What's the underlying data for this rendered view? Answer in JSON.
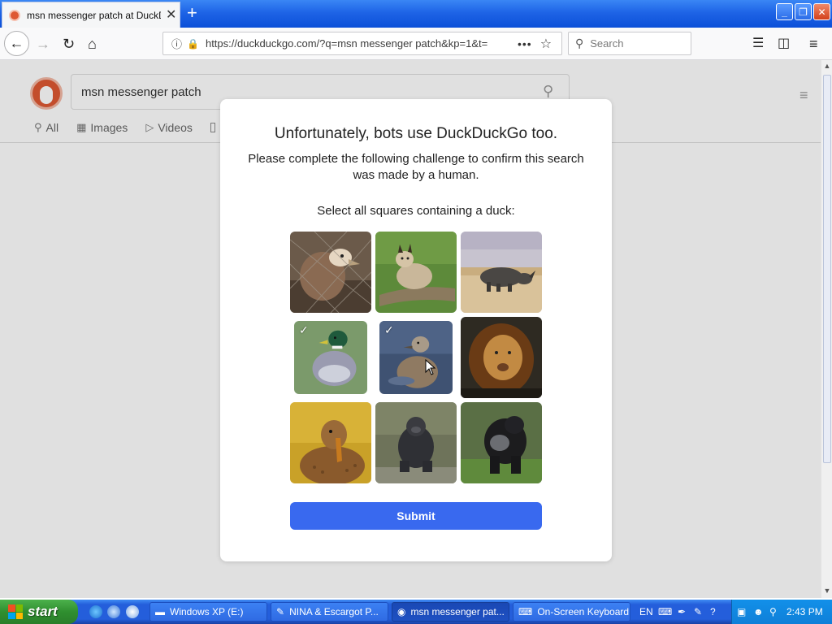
{
  "browser": {
    "tab_title": "msn messenger patch at DuckDuckGo",
    "tab_close": "✕",
    "new_tab": "+",
    "url": "https://duckduckgo.com/?q=msn messenger patch&kp=1&t=",
    "search_placeholder": "Search",
    "window_controls": {
      "minimize": "_",
      "maximize": "❐",
      "close": "✕"
    },
    "icons": {
      "back": "back-arrow-icon",
      "forward": "forward-arrow-icon",
      "reload": "reload-icon",
      "home": "home-icon",
      "info": "info-icon",
      "lock": "lock-icon",
      "page_actions": "more-dots-icon",
      "bookmark": "star-icon",
      "library": "library-icon",
      "sidebar": "sidebar-icon",
      "menu": "hamburger-icon"
    }
  },
  "ddg": {
    "query": "msn messenger patch",
    "tabs": [
      {
        "label": "All",
        "icon": "search-icon"
      },
      {
        "label": "Images",
        "icon": "image-icon"
      },
      {
        "label": "Videos",
        "icon": "play-icon"
      }
    ],
    "brand_color": "#de5833"
  },
  "challenge": {
    "title": "Unfortunately, bots use DuckDuckGo too.",
    "description": "Please complete the following challenge to confirm this search was made by a human.",
    "instruction": "Select all squares containing a duck:",
    "submit_label": "Submit",
    "submit_color": "#3969ef",
    "tiles": [
      {
        "subject": "vulture",
        "selected": false
      },
      {
        "subject": "lynx",
        "selected": false
      },
      {
        "subject": "rhino",
        "selected": false
      },
      {
        "subject": "duck",
        "selected": true
      },
      {
        "subject": "duck",
        "selected": true
      },
      {
        "subject": "lion",
        "selected": false
      },
      {
        "subject": "duck",
        "selected": false
      },
      {
        "subject": "gorilla",
        "selected": false
      },
      {
        "subject": "gorilla",
        "selected": false
      }
    ]
  },
  "taskbar": {
    "start_label": "start",
    "buttons": [
      {
        "label": "Windows XP (E:)",
        "active": false
      },
      {
        "label": "NINA & Escargot P...",
        "active": false
      },
      {
        "label": "msn messenger pat...",
        "active": true
      },
      {
        "label": "On-Screen Keyboard",
        "active": false
      }
    ],
    "language": "EN",
    "clock": "2:43 PM"
  }
}
